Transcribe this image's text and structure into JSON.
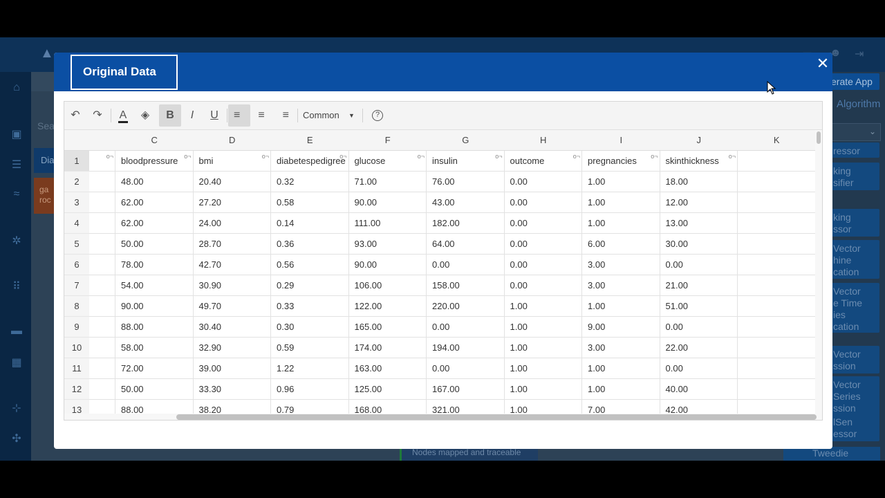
{
  "background": {
    "generate_label": "erate App",
    "algo_label": "Algorithm",
    "search_label": "Sea",
    "chip_blue": "Dia",
    "chip_orange": [
      "ga",
      "roc"
    ],
    "algo_items": [
      {
        "lines": [
          "ressor"
        ]
      },
      {
        "lines": [
          "king",
          "sifier"
        ]
      },
      {
        "lines": [
          "king",
          "ssor"
        ]
      },
      {
        "lines": [
          "Vector",
          "hine",
          "cation"
        ]
      },
      {
        "lines": [
          "Vector",
          "e Time",
          "ies",
          "cation"
        ]
      },
      {
        "lines": [
          "Vector",
          "ssion"
        ]
      },
      {
        "lines": [
          "Vector",
          "Series",
          "ssion"
        ]
      },
      {
        "lines": [
          "lSen",
          "essor"
        ]
      }
    ],
    "bottom_chip": "Tweedie",
    "status_text": "Nodes mapped and traceable"
  },
  "modal": {
    "title": "Original Data",
    "close_glyph": "✕"
  },
  "toolbar": {
    "undo_glyph": "↶",
    "redo_glyph": "↷",
    "font_color_glyph": "A",
    "fill_glyph": "◈",
    "bold_glyph": "B",
    "italic_glyph": "I",
    "underline_glyph": "U",
    "align_left_glyph": "≡",
    "align_center_glyph": "≡",
    "align_right_glyph": "≡",
    "font_label": "Common",
    "caret_glyph": "▼",
    "help_glyph": "?"
  },
  "sheet": {
    "column_letters": [
      "C",
      "D",
      "E",
      "F",
      "G",
      "H",
      "I",
      "J",
      "K"
    ],
    "row_numbers": [
      "1",
      "2",
      "3",
      "4",
      "5",
      "6",
      "7",
      "8",
      "9",
      "10",
      "11",
      "12",
      "13"
    ],
    "headers": [
      "bloodpressure",
      "bmi",
      "diabetespedigree",
      "glucose",
      "insulin",
      "outcome",
      "pregnancies",
      "skinthickness",
      ""
    ],
    "rows": [
      [
        "48.00",
        "20.40",
        "0.32",
        "71.00",
        "76.00",
        "0.00",
        "1.00",
        "18.00",
        ""
      ],
      [
        "62.00",
        "27.20",
        "0.58",
        "90.00",
        "43.00",
        "0.00",
        "1.00",
        "12.00",
        ""
      ],
      [
        "62.00",
        "24.00",
        "0.14",
        "111.00",
        "182.00",
        "0.00",
        "1.00",
        "13.00",
        ""
      ],
      [
        "50.00",
        "28.70",
        "0.36",
        "93.00",
        "64.00",
        "0.00",
        "6.00",
        "30.00",
        ""
      ],
      [
        "78.00",
        "42.70",
        "0.56",
        "90.00",
        "0.00",
        "0.00",
        "3.00",
        "0.00",
        ""
      ],
      [
        "54.00",
        "30.90",
        "0.29",
        "106.00",
        "158.00",
        "0.00",
        "3.00",
        "21.00",
        ""
      ],
      [
        "90.00",
        "49.70",
        "0.33",
        "122.00",
        "220.00",
        "1.00",
        "1.00",
        "51.00",
        ""
      ],
      [
        "88.00",
        "30.40",
        "0.30",
        "165.00",
        "0.00",
        "1.00",
        "9.00",
        "0.00",
        ""
      ],
      [
        "58.00",
        "32.90",
        "0.59",
        "174.00",
        "194.00",
        "1.00",
        "3.00",
        "22.00",
        ""
      ],
      [
        "72.00",
        "39.00",
        "1.22",
        "163.00",
        "0.00",
        "1.00",
        "1.00",
        "0.00",
        ""
      ],
      [
        "50.00",
        "33.30",
        "0.96",
        "125.00",
        "167.00",
        "1.00",
        "1.00",
        "40.00",
        ""
      ],
      [
        "88.00",
        "38.20",
        "0.79",
        "168.00",
        "321.00",
        "1.00",
        "7.00",
        "42.00",
        ""
      ]
    ]
  }
}
